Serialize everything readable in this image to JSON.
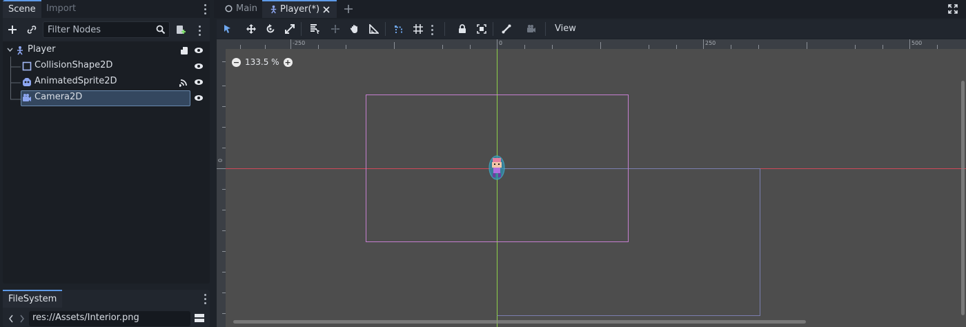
{
  "scene_dock": {
    "tabs": [
      {
        "label": "Scene",
        "active": true
      },
      {
        "label": "Import",
        "active": false
      }
    ],
    "filter": {
      "placeholder": "Filter Nodes",
      "value": ""
    },
    "tree": [
      {
        "label": "Player",
        "icon": "character-body-icon",
        "depth": 0,
        "expanded": true,
        "selected": false,
        "badges": [
          "script-icon",
          "visibility-eye-icon"
        ]
      },
      {
        "label": "CollisionShape2D",
        "icon": "collision-shape-icon",
        "depth": 1,
        "selected": false,
        "badges": [
          "visibility-eye-icon"
        ]
      },
      {
        "label": "AnimatedSprite2D",
        "icon": "animated-sprite-icon",
        "depth": 1,
        "selected": false,
        "badges": [
          "signal-icon",
          "visibility-eye-icon"
        ]
      },
      {
        "label": "Camera2D",
        "icon": "camera-icon",
        "depth": 1,
        "selected": true,
        "badges": [
          "visibility-eye-icon"
        ]
      }
    ]
  },
  "filesystem_dock": {
    "tab": "FileSystem",
    "path": "res://Assets/Interior.png"
  },
  "editor_tabs": [
    {
      "label": "Main",
      "icon": "scene-circle-icon",
      "active": false
    },
    {
      "label": "Player(*)",
      "icon": "character-body-icon",
      "active": true
    }
  ],
  "toolbar": {
    "view_label": "View"
  },
  "viewport": {
    "zoom": "133.5 %",
    "ruler_top_labels": [
      "-250",
      "0",
      "250",
      "500"
    ],
    "ruler_left_labels": [
      "0"
    ]
  },
  "colors": {
    "accent": "#5e9ae8",
    "viewport_bg": "#4d4d4d",
    "camera_rect": "#c77fd1",
    "x_axis": "#d0485a",
    "y_axis": "#8fd24a"
  }
}
